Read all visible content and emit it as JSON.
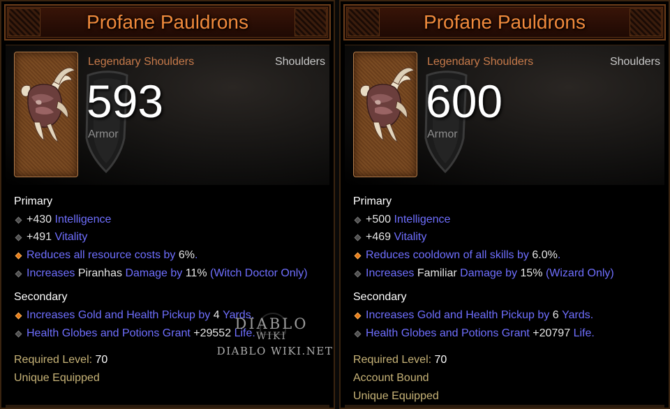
{
  "cards": [
    {
      "name": "Profane Pauldrons",
      "type": "Legendary Shoulders",
      "slot": "Shoulders",
      "armor_value": "593",
      "armor_label": "Armor",
      "primary_title": "Primary",
      "primary": [
        {
          "value": "+430",
          "stat": "Intelligence"
        },
        {
          "value": "+491",
          "stat": "Vitality"
        },
        {
          "text": "Reduces all resource costs by",
          "value": "6%",
          "tail": "."
        },
        {
          "pre": "Increases",
          "skill": "Piranhas",
          "mid": "Damage by",
          "value": "11%",
          "note": "(Witch Doctor Only)"
        }
      ],
      "secondary_title": "Secondary",
      "secondary": [
        {
          "text": "Increases Gold and Health Pickup by",
          "value": "4",
          "unit": "Yards."
        },
        {
          "text": "Health Globes and Potions Grant",
          "value": "+29552",
          "unit": "Life."
        }
      ],
      "required_level_label": "Required Level:",
      "required_level": "70",
      "footer": [
        "Unique Equipped"
      ]
    },
    {
      "name": "Profane Pauldrons",
      "type": "Legendary Shoulders",
      "slot": "Shoulders",
      "armor_value": "600",
      "armor_label": "Armor",
      "primary_title": "Primary",
      "primary": [
        {
          "value": "+500",
          "stat": "Intelligence"
        },
        {
          "value": "+469",
          "stat": "Vitality"
        },
        {
          "text": "Reduces cooldown of all skills by",
          "value": "6.0%",
          "tail": "."
        },
        {
          "pre": "Increases",
          "skill": "Familiar",
          "mid": "Damage by",
          "value": "15%",
          "note": "(Wizard Only)"
        }
      ],
      "secondary_title": "Secondary",
      "secondary": [
        {
          "text": "Increases Gold and Health Pickup by",
          "value": "6",
          "unit": "Yards."
        },
        {
          "text": "Health Globes and Potions Grant",
          "value": "+20797",
          "unit": "Life."
        }
      ],
      "required_level_label": "Required Level:",
      "required_level": "70",
      "footer": [
        "Account Bound",
        "Unique Equipped"
      ]
    }
  ],
  "watermark": {
    "top": "DIABLO",
    "sub": "WIKI",
    "domain": "DIABLO WIKI.NET"
  },
  "colors": {
    "item_name": "#f08a3c",
    "legendary_type": "#c77a4a",
    "magic_blue": "#6f6fff",
    "gold_bullet": "#e97a16"
  }
}
